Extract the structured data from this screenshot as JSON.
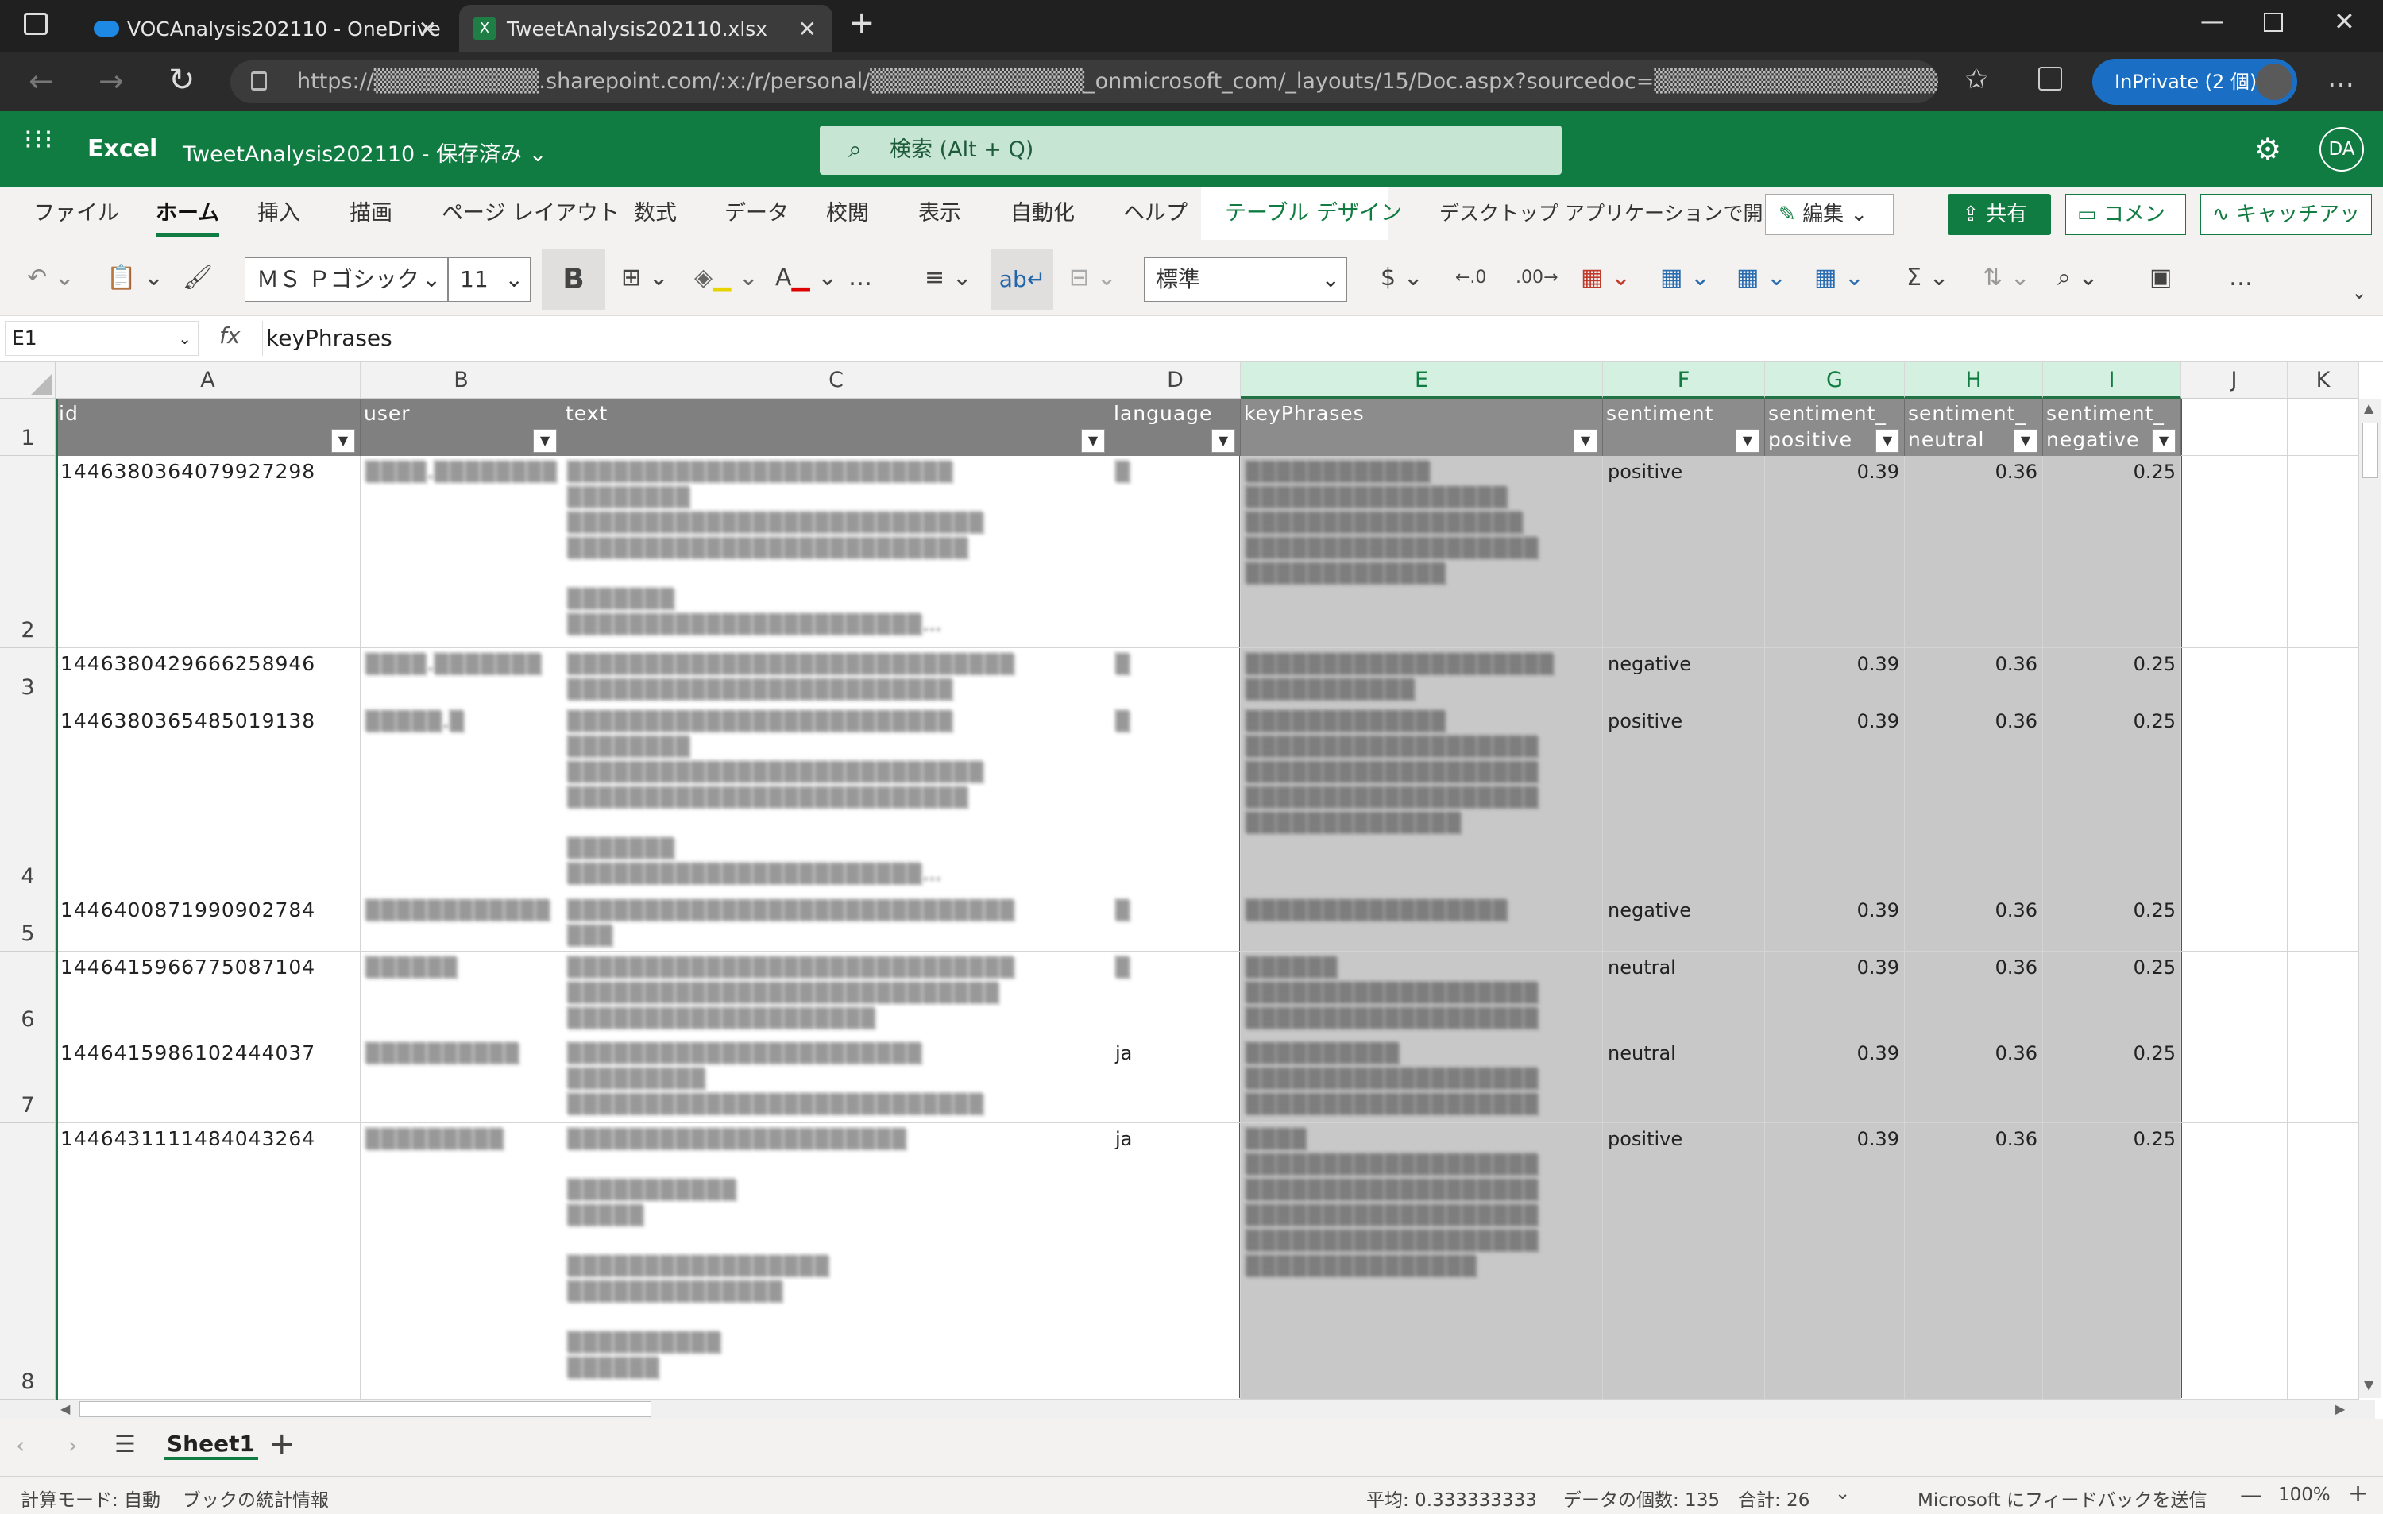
{
  "browser": {
    "tabs": [
      {
        "title": "VOCAnalysis202110 - OneDrive",
        "active": false
      },
      {
        "title": "TweetAnalysis202110.xlsx",
        "active": true
      }
    ],
    "url": "https://▒▒▒▒▒▒▒▒▒▒.sharepoint.com/:x:/r/personal/▒▒▒▒▒▒▒▒▒▒▒▒▒_onmicrosoft_com/_layouts/15/Doc.aspx?sourcedoc=▒▒▒▒▒▒▒▒▒▒▒▒▒▒▒▒▒▒▒...",
    "inprivate_label": "InPrivate (2 個)"
  },
  "excel": {
    "app_name": "Excel",
    "doc_title": "TweetAnalysis202110 - 保存済み",
    "search_placeholder": "検索 (Alt + Q)",
    "user_initials": "DA",
    "ribbon_tabs": [
      "ファイル",
      "ホーム",
      "挿入",
      "描画",
      "ページ レイアウト",
      "数式",
      "データ",
      "校閲",
      "表示",
      "自動化",
      "ヘルプ",
      "テーブル デザイン"
    ],
    "open_desktop": "デスクトップ アプリケーションで開く",
    "edit_label": "編集",
    "share_label": "共有",
    "comment_label": "コメント",
    "catchup_label": "キャッチアップ",
    "font_name": "ＭＳ Ｐゴシック",
    "font_size": "11",
    "number_format": "標準",
    "name_box": "E1",
    "formula": "keyPhrases"
  },
  "grid": {
    "columns": [
      "A",
      "B",
      "C",
      "D",
      "E",
      "F",
      "G",
      "H",
      "I",
      "J",
      "K"
    ],
    "headers": [
      "id",
      "user",
      "text",
      "language",
      "keyPhrases",
      "sentiment",
      "sentiment_\npositive",
      "sentiment_\nneutral",
      "sentiment_\nnegative"
    ],
    "rows": [
      {
        "num": "2",
        "id": "1446380364079927298",
        "user": "▒▒▒▒.▒▒▒▒▒▒▒▒",
        "text": "▒▒▒▒▒▒▒▒▒▒▒▒▒▒▒▒▒▒▒▒▒▒▒▒▒\n▒▒▒▒▒▒▒▒\n▒▒▒▒▒▒▒▒▒▒▒▒▒▒▒▒▒▒▒▒▒▒▒▒▒▒▒\n▒▒▒▒▒▒▒▒▒▒▒▒▒▒▒▒▒▒▒▒▒▒▒▒▒▒\n\n▒▒▒▒▒▒▒\n▒▒▒▒▒▒▒▒▒▒▒▒▒▒▒▒▒▒▒▒▒▒▒…",
        "lang": "▒",
        "key": "▒▒▒▒▒▒▒▒▒▒▒▒\n▒▒▒▒▒▒▒▒▒▒▒▒▒▒▒▒▒\n▒▒▒▒▒▒▒▒▒▒▒▒▒▒▒▒▒▒\n▒▒▒▒▒▒▒▒▒▒▒▒▒▒▒▒▒▒▒\n▒▒▒▒▒▒▒▒▒▒▒▒▒",
        "sentiment": "positive",
        "pos": "0.39",
        "neu": "0.36",
        "neg": "0.25"
      },
      {
        "num": "3",
        "id": "1446380429666258946",
        "user": "▒▒▒▒.▒▒▒▒▒▒▒",
        "text": "▒▒▒▒▒▒▒▒▒▒▒▒▒▒▒▒▒▒▒▒▒▒▒▒▒▒▒▒▒\n▒▒▒▒▒▒▒▒▒▒▒▒▒▒▒▒▒▒▒▒▒▒▒▒▒",
        "lang": "▒",
        "key": "▒▒▒▒▒▒▒▒▒▒▒▒▒▒▒▒▒▒▒▒\n▒▒▒▒▒▒▒▒▒▒▒",
        "sentiment": "negative",
        "pos": "0.39",
        "neu": "0.36",
        "neg": "0.25"
      },
      {
        "num": "4",
        "id": "1446380365485019138",
        "user": "▒▒▒▒▒.▒",
        "text": "▒▒▒▒▒▒▒▒▒▒▒▒▒▒▒▒▒▒▒▒▒▒▒▒▒\n▒▒▒▒▒▒▒▒\n▒▒▒▒▒▒▒▒▒▒▒▒▒▒▒▒▒▒▒▒▒▒▒▒▒▒▒\n▒▒▒▒▒▒▒▒▒▒▒▒▒▒▒▒▒▒▒▒▒▒▒▒▒▒\n\n▒▒▒▒▒▒▒\n▒▒▒▒▒▒▒▒▒▒▒▒▒▒▒▒▒▒▒▒▒▒▒…",
        "lang": "▒",
        "key": "▒▒▒▒▒▒▒▒▒▒▒▒▒\n▒▒▒▒▒▒▒▒▒▒▒▒▒▒▒▒▒▒▒\n▒▒▒▒▒▒▒▒▒▒▒▒▒▒▒▒▒▒▒\n▒▒▒▒▒▒▒▒▒▒▒▒▒▒▒▒▒▒▒\n▒▒▒▒▒▒▒▒▒▒▒▒▒▒",
        "sentiment": "positive",
        "pos": "0.39",
        "neu": "0.36",
        "neg": "0.25"
      },
      {
        "num": "5",
        "id": "1446400871990902784",
        "user": "▒▒▒▒▒▒▒▒▒▒▒▒",
        "text": "▒▒▒▒▒▒▒▒▒▒▒▒▒▒▒▒▒▒▒▒▒▒▒▒▒▒▒▒▒\n▒▒▒",
        "lang": "▒",
        "key": "▒▒▒▒▒▒▒▒▒▒▒▒▒▒▒▒▒",
        "sentiment": "negative",
        "pos": "0.39",
        "neu": "0.36",
        "neg": "0.25"
      },
      {
        "num": "6",
        "id": "1446415966775087104",
        "user": "▒▒▒▒▒▒",
        "text": "▒▒▒▒▒▒▒▒▒▒▒▒▒▒▒▒▒▒▒▒▒▒▒▒▒▒▒▒▒\n▒▒▒▒▒▒▒▒▒▒▒▒▒▒▒▒▒▒▒▒▒▒▒▒▒▒▒▒\n▒▒▒▒▒▒▒▒▒▒▒▒▒▒▒▒▒▒▒▒",
        "lang": "▒",
        "key": "▒▒▒▒▒▒\n▒▒▒▒▒▒▒▒▒▒▒▒▒▒▒▒▒▒▒\n▒▒▒▒▒▒▒▒▒▒▒▒▒▒▒▒▒▒▒",
        "sentiment": "neutral",
        "pos": "0.39",
        "neu": "0.36",
        "neg": "0.25"
      },
      {
        "num": "7",
        "id": "1446415986102444037",
        "user": "▒▒▒▒▒▒▒▒▒▒",
        "text": "▒▒▒▒▒▒▒▒▒▒▒▒▒▒▒▒▒▒▒▒▒▒▒\n▒▒▒▒▒▒▒▒▒\n▒▒▒▒▒▒▒▒▒▒▒▒▒▒▒▒▒▒▒▒▒▒▒▒▒▒▒",
        "lang": "ja",
        "key": "▒▒▒▒▒▒▒▒▒▒\n▒▒▒▒▒▒▒▒▒▒▒▒▒▒▒▒▒▒▒\n▒▒▒▒▒▒▒▒▒▒▒▒▒▒▒▒▒▒▒",
        "sentiment": "neutral",
        "pos": "0.39",
        "neu": "0.36",
        "neg": "0.25"
      },
      {
        "num": "8",
        "id": "1446431111484043264",
        "user": "▒▒▒▒▒▒▒▒▒",
        "text": "▒▒▒▒▒▒▒▒▒▒▒▒▒▒▒▒▒▒▒▒▒▒\n\n▒▒▒▒▒▒▒▒▒▒▒\n▒▒▒▒▒\n\n▒▒▒▒▒▒▒▒▒▒▒▒▒▒▒▒▒\n▒▒▒▒▒▒▒▒▒▒▒▒▒▒\n\n▒▒▒▒▒▒▒▒▒▒\n▒▒▒▒▒▒",
        "lang": "ja",
        "key": "▒▒▒▒\n▒▒▒▒▒▒▒▒▒▒▒▒▒▒▒▒▒▒▒\n▒▒▒▒▒▒▒▒▒▒▒▒▒▒▒▒▒▒▒\n▒▒▒▒▒▒▒▒▒▒▒▒▒▒▒▒▒▒▒\n▒▒▒▒▒▒▒▒▒▒▒▒▒▒▒▒▒▒▒\n▒▒▒▒▒▒▒▒▒▒▒▒▒▒▒",
        "sentiment": "positive",
        "pos": "0.39",
        "neu": "0.36",
        "neg": "0.25"
      }
    ]
  },
  "sheet": {
    "name": "Sheet1"
  },
  "status": {
    "calc_mode": "計算モード: 自動",
    "stats": "ブックの統計情報",
    "average": "平均: 0.333333333",
    "count": "データの個数: 135",
    "sum": "合計: 26",
    "feedback": "Microsoft にフィードバックを送信",
    "zoom": "100%"
  },
  "colors": {
    "excel_green": "#107c41",
    "header_fill": "#808080",
    "selection_fill": "#c8c8c8"
  }
}
